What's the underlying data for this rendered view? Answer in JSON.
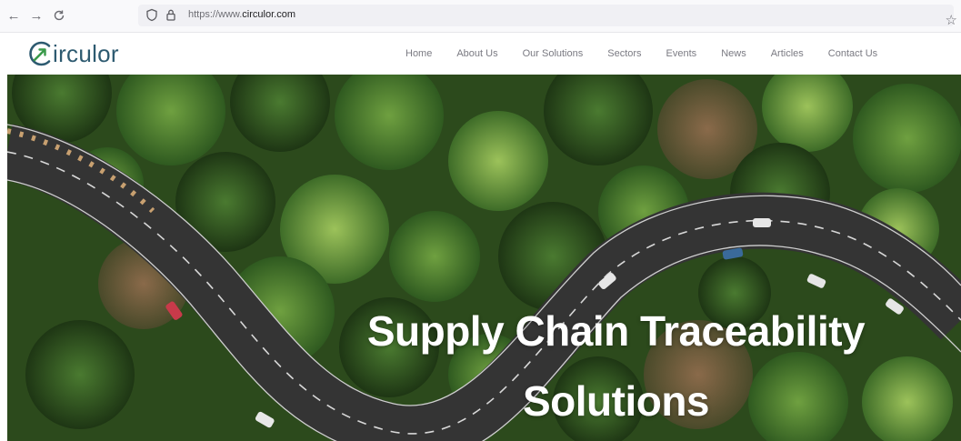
{
  "browser": {
    "url_prefix": "https://www.",
    "url_domain": "circulor.com",
    "icons": [
      "back-arrow-icon",
      "forward-arrow-icon",
      "reload-icon",
      "shield-icon",
      "lock-icon",
      "star-icon"
    ]
  },
  "header": {
    "logo_text": "irculor",
    "nav": [
      "Home",
      "About Us",
      "Our Solutions",
      "Sectors",
      "Events",
      "News",
      "Articles",
      "Contact Us"
    ]
  },
  "hero": {
    "title_line1": "Supply Chain Traceability",
    "title_line2": "Solutions"
  },
  "colors": {
    "logo": "#2d5a70",
    "logo_arrow": "#3a9a4a",
    "nav_text": "#7a7a82",
    "forest_dark": "#2e4a1d",
    "road": "#3a3a3a"
  }
}
